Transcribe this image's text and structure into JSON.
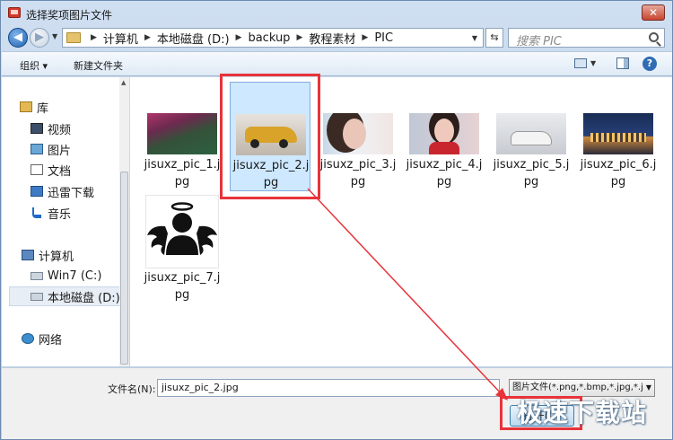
{
  "window": {
    "title": "选择奖项图片文件",
    "close_label": "✕"
  },
  "address": {
    "crumbs": [
      "计算机",
      "本地磁盘 (D:)",
      "backup",
      "教程素材",
      "PIC"
    ]
  },
  "search": {
    "placeholder": "搜索 PIC"
  },
  "toolbar": {
    "organize_label": "组织 ▾",
    "new_folder_label": "新建文件夹"
  },
  "sidebar": {
    "items": [
      {
        "label": "库",
        "icon": "library-icon"
      },
      {
        "label": "视频",
        "icon": "video-icon"
      },
      {
        "label": "图片",
        "icon": "image-icon"
      },
      {
        "label": "文档",
        "icon": "document-icon"
      },
      {
        "label": "迅雷下载",
        "icon": "xunlei-icon"
      },
      {
        "label": "音乐",
        "icon": "music-icon"
      },
      {
        "label": "计算机",
        "icon": "computer-icon"
      },
      {
        "label": "Win7 (C:)",
        "icon": "drive-icon"
      },
      {
        "label": "本地磁盘 (D:)",
        "icon": "drive-icon"
      },
      {
        "label": "网络",
        "icon": "network-icon"
      }
    ],
    "selected_index": 8
  },
  "files": [
    {
      "name": "jisuxz_pic_1.jpg"
    },
    {
      "name": "jisuxz_pic_2.jpg"
    },
    {
      "name": "jisuxz_pic_3.jpg"
    },
    {
      "name": "jisuxz_pic_4.jpg"
    },
    {
      "name": "jisuxz_pic_5.jpg"
    },
    {
      "name": "jisuxz_pic_6.jpg"
    },
    {
      "name": "jisuxz_pic_7.jpg"
    }
  ],
  "selected_file_index": 1,
  "footer": {
    "filename_label": "文件名(N):",
    "filename_value": "jisuxz_pic_2.jpg",
    "filetype_value": "图片文件(*.png,*.bmp,*.jpg,*.j",
    "open_label": "打开(O)"
  },
  "watermark": "极速下载站",
  "colors": {
    "annotation": "#e8333a",
    "selection": "#cde8ff"
  }
}
